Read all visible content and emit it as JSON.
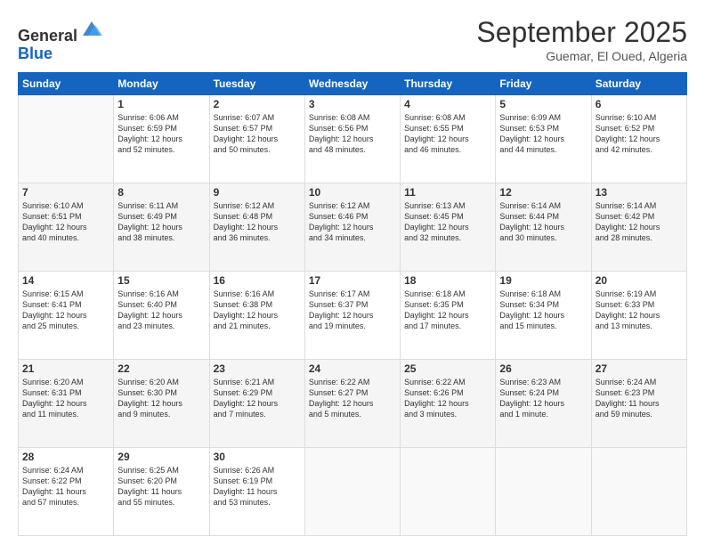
{
  "logo": {
    "general": "General",
    "blue": "Blue"
  },
  "header": {
    "month": "September 2025",
    "location": "Guemar, El Oued, Algeria"
  },
  "weekdays": [
    "Sunday",
    "Monday",
    "Tuesday",
    "Wednesday",
    "Thursday",
    "Friday",
    "Saturday"
  ],
  "weeks": [
    [
      {
        "day": "",
        "info": ""
      },
      {
        "day": "1",
        "info": "Sunrise: 6:06 AM\nSunset: 6:59 PM\nDaylight: 12 hours\nand 52 minutes."
      },
      {
        "day": "2",
        "info": "Sunrise: 6:07 AM\nSunset: 6:57 PM\nDaylight: 12 hours\nand 50 minutes."
      },
      {
        "day": "3",
        "info": "Sunrise: 6:08 AM\nSunset: 6:56 PM\nDaylight: 12 hours\nand 48 minutes."
      },
      {
        "day": "4",
        "info": "Sunrise: 6:08 AM\nSunset: 6:55 PM\nDaylight: 12 hours\nand 46 minutes."
      },
      {
        "day": "5",
        "info": "Sunrise: 6:09 AM\nSunset: 6:53 PM\nDaylight: 12 hours\nand 44 minutes."
      },
      {
        "day": "6",
        "info": "Sunrise: 6:10 AM\nSunset: 6:52 PM\nDaylight: 12 hours\nand 42 minutes."
      }
    ],
    [
      {
        "day": "7",
        "info": "Sunrise: 6:10 AM\nSunset: 6:51 PM\nDaylight: 12 hours\nand 40 minutes."
      },
      {
        "day": "8",
        "info": "Sunrise: 6:11 AM\nSunset: 6:49 PM\nDaylight: 12 hours\nand 38 minutes."
      },
      {
        "day": "9",
        "info": "Sunrise: 6:12 AM\nSunset: 6:48 PM\nDaylight: 12 hours\nand 36 minutes."
      },
      {
        "day": "10",
        "info": "Sunrise: 6:12 AM\nSunset: 6:46 PM\nDaylight: 12 hours\nand 34 minutes."
      },
      {
        "day": "11",
        "info": "Sunrise: 6:13 AM\nSunset: 6:45 PM\nDaylight: 12 hours\nand 32 minutes."
      },
      {
        "day": "12",
        "info": "Sunrise: 6:14 AM\nSunset: 6:44 PM\nDaylight: 12 hours\nand 30 minutes."
      },
      {
        "day": "13",
        "info": "Sunrise: 6:14 AM\nSunset: 6:42 PM\nDaylight: 12 hours\nand 28 minutes."
      }
    ],
    [
      {
        "day": "14",
        "info": "Sunrise: 6:15 AM\nSunset: 6:41 PM\nDaylight: 12 hours\nand 25 minutes."
      },
      {
        "day": "15",
        "info": "Sunrise: 6:16 AM\nSunset: 6:40 PM\nDaylight: 12 hours\nand 23 minutes."
      },
      {
        "day": "16",
        "info": "Sunrise: 6:16 AM\nSunset: 6:38 PM\nDaylight: 12 hours\nand 21 minutes."
      },
      {
        "day": "17",
        "info": "Sunrise: 6:17 AM\nSunset: 6:37 PM\nDaylight: 12 hours\nand 19 minutes."
      },
      {
        "day": "18",
        "info": "Sunrise: 6:18 AM\nSunset: 6:35 PM\nDaylight: 12 hours\nand 17 minutes."
      },
      {
        "day": "19",
        "info": "Sunrise: 6:18 AM\nSunset: 6:34 PM\nDaylight: 12 hours\nand 15 minutes."
      },
      {
        "day": "20",
        "info": "Sunrise: 6:19 AM\nSunset: 6:33 PM\nDaylight: 12 hours\nand 13 minutes."
      }
    ],
    [
      {
        "day": "21",
        "info": "Sunrise: 6:20 AM\nSunset: 6:31 PM\nDaylight: 12 hours\nand 11 minutes."
      },
      {
        "day": "22",
        "info": "Sunrise: 6:20 AM\nSunset: 6:30 PM\nDaylight: 12 hours\nand 9 minutes."
      },
      {
        "day": "23",
        "info": "Sunrise: 6:21 AM\nSunset: 6:29 PM\nDaylight: 12 hours\nand 7 minutes."
      },
      {
        "day": "24",
        "info": "Sunrise: 6:22 AM\nSunset: 6:27 PM\nDaylight: 12 hours\nand 5 minutes."
      },
      {
        "day": "25",
        "info": "Sunrise: 6:22 AM\nSunset: 6:26 PM\nDaylight: 12 hours\nand 3 minutes."
      },
      {
        "day": "26",
        "info": "Sunrise: 6:23 AM\nSunset: 6:24 PM\nDaylight: 12 hours\nand 1 minute."
      },
      {
        "day": "27",
        "info": "Sunrise: 6:24 AM\nSunset: 6:23 PM\nDaylight: 11 hours\nand 59 minutes."
      }
    ],
    [
      {
        "day": "28",
        "info": "Sunrise: 6:24 AM\nSunset: 6:22 PM\nDaylight: 11 hours\nand 57 minutes."
      },
      {
        "day": "29",
        "info": "Sunrise: 6:25 AM\nSunset: 6:20 PM\nDaylight: 11 hours\nand 55 minutes."
      },
      {
        "day": "30",
        "info": "Sunrise: 6:26 AM\nSunset: 6:19 PM\nDaylight: 11 hours\nand 53 minutes."
      },
      {
        "day": "",
        "info": ""
      },
      {
        "day": "",
        "info": ""
      },
      {
        "day": "",
        "info": ""
      },
      {
        "day": "",
        "info": ""
      }
    ]
  ]
}
